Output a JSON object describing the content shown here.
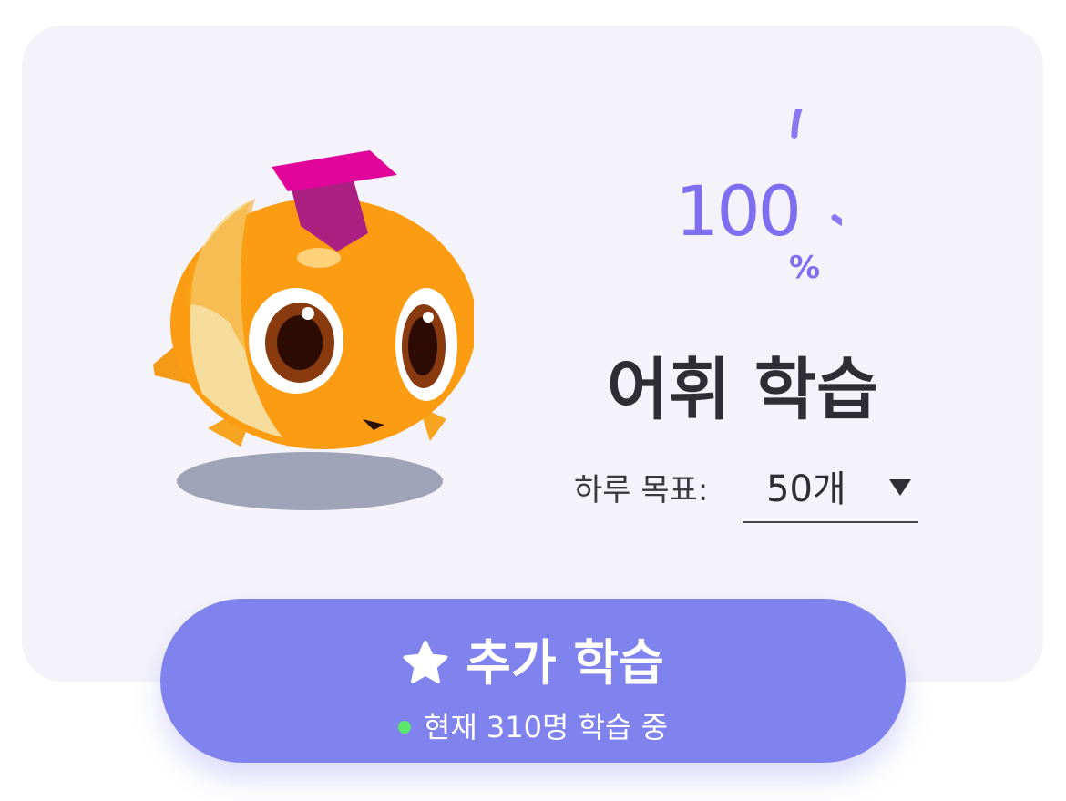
{
  "progress": {
    "value": "100",
    "unit": "%",
    "fraction": 1.0
  },
  "title": "어휘 학습",
  "goal": {
    "label": "하루 목표:",
    "selected": "50개"
  },
  "cta": {
    "label": "추가 학습",
    "status_text": "현재 310명 학습 중"
  },
  "colors": {
    "accent": "#7f6ff0",
    "button": "#8083ee",
    "card_background": "#f4f3f9",
    "live_dot": "#59e86b",
    "text_dark": "#2f2f33"
  },
  "icons": {
    "mascot": "fish-mascot-icon",
    "cta_icon": "star-icon",
    "dropdown": "triangle-down-icon"
  }
}
